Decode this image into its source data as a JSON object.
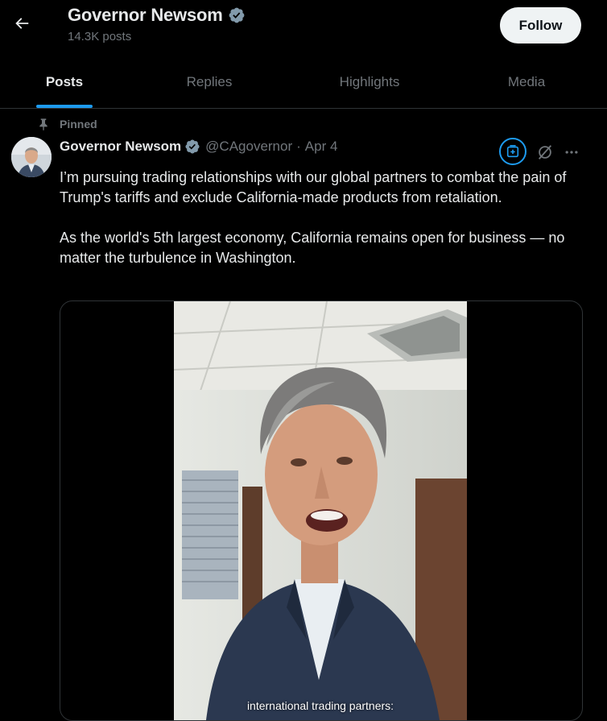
{
  "header": {
    "title": "Governor Newsom",
    "posts_count": "14.3K posts",
    "follow_label": "Follow"
  },
  "tabs": [
    {
      "label": "Posts",
      "active": true
    },
    {
      "label": "Replies",
      "active": false
    },
    {
      "label": "Highlights",
      "active": false
    },
    {
      "label": "Media",
      "active": false
    }
  ],
  "post": {
    "pinned_label": "Pinned",
    "author": "Governor Newsom",
    "handle": "@CAgovernor",
    "separator": "·",
    "date": "Apr 4",
    "text_p1": "I’m pursuing trading relationships with our global partners to combat the pain of Trump's tariffs and exclude California-made products from retaliation.",
    "text_p2": "As the world's 5th largest economy, California remains open for business — no matter the turbulence in Washington.",
    "video_caption": "international trading partners:"
  },
  "icons": {
    "back": "arrow-left-icon",
    "verified": "verified-badge-icon",
    "pin": "pin-icon",
    "grok": "grok-icon",
    "slash": "circle-slash-icon",
    "more": "more-icon"
  },
  "colors": {
    "background": "#000000",
    "text": "#e7e9ea",
    "muted": "#71767b",
    "accent": "#1d9bf0",
    "verified": "#829aab",
    "follow_bg": "#eff3f4"
  }
}
